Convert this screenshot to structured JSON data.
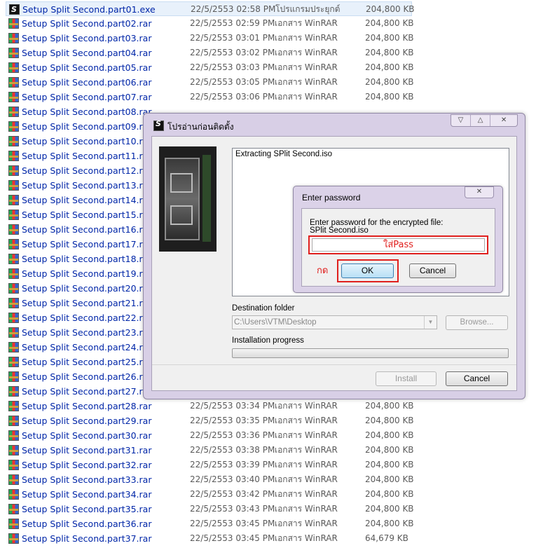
{
  "files": [
    {
      "name": "Setup Split Second.part01.exe",
      "date": "22/5/2553 02:58 PM",
      "type": "โปรแกรมประยุกต์",
      "size": "204,800 KB",
      "icon": "exe-icon"
    },
    {
      "name": "Setup Split Second.part02.rar",
      "date": "22/5/2553 02:59 PM",
      "type": "เอกสาร WinRAR",
      "size": "204,800 KB",
      "icon": "rar-icon"
    },
    {
      "name": "Setup Split Second.part03.rar",
      "date": "22/5/2553 03:01 PM",
      "type": "เอกสาร WinRAR",
      "size": "204,800 KB",
      "icon": "rar-icon"
    },
    {
      "name": "Setup Split Second.part04.rar",
      "date": "22/5/2553 03:02 PM",
      "type": "เอกสาร WinRAR",
      "size": "204,800 KB",
      "icon": "rar-icon"
    },
    {
      "name": "Setup Split Second.part05.rar",
      "date": "22/5/2553 03:03 PM",
      "type": "เอกสาร WinRAR",
      "size": "204,800 KB",
      "icon": "rar-icon"
    },
    {
      "name": "Setup Split Second.part06.rar",
      "date": "22/5/2553 03:05 PM",
      "type": "เอกสาร WinRAR",
      "size": "204,800 KB",
      "icon": "rar-icon"
    },
    {
      "name": "Setup Split Second.part07.rar",
      "date": "22/5/2553 03:06 PM",
      "type": "เอกสาร WinRAR",
      "size": "204,800 KB",
      "icon": "rar-icon"
    },
    {
      "name": "Setup Split Second.part08.rar",
      "date": "",
      "type": "",
      "size": "",
      "icon": "rar-icon"
    },
    {
      "name": "Setup Split Second.part09.rar",
      "date": "",
      "type": "",
      "size": "",
      "icon": "rar-icon"
    },
    {
      "name": "Setup Split Second.part10.rar",
      "date": "",
      "type": "",
      "size": "",
      "icon": "rar-icon"
    },
    {
      "name": "Setup Split Second.part11.rar",
      "date": "",
      "type": "",
      "size": "",
      "icon": "rar-icon"
    },
    {
      "name": "Setup Split Second.part12.rar",
      "date": "",
      "type": "",
      "size": "",
      "icon": "rar-icon"
    },
    {
      "name": "Setup Split Second.part13.rar",
      "date": "",
      "type": "",
      "size": "",
      "icon": "rar-icon"
    },
    {
      "name": "Setup Split Second.part14.rar",
      "date": "",
      "type": "",
      "size": "",
      "icon": "rar-icon"
    },
    {
      "name": "Setup Split Second.part15.rar",
      "date": "",
      "type": "",
      "size": "",
      "icon": "rar-icon"
    },
    {
      "name": "Setup Split Second.part16.rar",
      "date": "",
      "type": "",
      "size": "",
      "icon": "rar-icon"
    },
    {
      "name": "Setup Split Second.part17.rar",
      "date": "",
      "type": "",
      "size": "",
      "icon": "rar-icon"
    },
    {
      "name": "Setup Split Second.part18.rar",
      "date": "",
      "type": "",
      "size": "",
      "icon": "rar-icon"
    },
    {
      "name": "Setup Split Second.part19.rar",
      "date": "",
      "type": "",
      "size": "",
      "icon": "rar-icon"
    },
    {
      "name": "Setup Split Second.part20.rar",
      "date": "",
      "type": "",
      "size": "",
      "icon": "rar-icon"
    },
    {
      "name": "Setup Split Second.part21.rar",
      "date": "",
      "type": "",
      "size": "",
      "icon": "rar-icon"
    },
    {
      "name": "Setup Split Second.part22.rar",
      "date": "",
      "type": "",
      "size": "",
      "icon": "rar-icon"
    },
    {
      "name": "Setup Split Second.part23.rar",
      "date": "",
      "type": "",
      "size": "",
      "icon": "rar-icon"
    },
    {
      "name": "Setup Split Second.part24.rar",
      "date": "",
      "type": "",
      "size": "",
      "icon": "rar-icon"
    },
    {
      "name": "Setup Split Second.part25.rar",
      "date": "",
      "type": "",
      "size": "",
      "icon": "rar-icon"
    },
    {
      "name": "Setup Split Second.part26.rar",
      "date": "",
      "type": "",
      "size": "",
      "icon": "rar-icon"
    },
    {
      "name": "Setup Split Second.part27.rar",
      "date": "",
      "type": "",
      "size": "",
      "icon": "rar-icon"
    },
    {
      "name": "Setup Split Second.part28.rar",
      "date": "22/5/2553 03:34 PM",
      "type": "เอกสาร WinRAR",
      "size": "204,800 KB",
      "icon": "rar-icon"
    },
    {
      "name": "Setup Split Second.part29.rar",
      "date": "22/5/2553 03:35 PM",
      "type": "เอกสาร WinRAR",
      "size": "204,800 KB",
      "icon": "rar-icon"
    },
    {
      "name": "Setup Split Second.part30.rar",
      "date": "22/5/2553 03:36 PM",
      "type": "เอกสาร WinRAR",
      "size": "204,800 KB",
      "icon": "rar-icon"
    },
    {
      "name": "Setup Split Second.part31.rar",
      "date": "22/5/2553 03:38 PM",
      "type": "เอกสาร WinRAR",
      "size": "204,800 KB",
      "icon": "rar-icon"
    },
    {
      "name": "Setup Split Second.part32.rar",
      "date": "22/5/2553 03:39 PM",
      "type": "เอกสาร WinRAR",
      "size": "204,800 KB",
      "icon": "rar-icon"
    },
    {
      "name": "Setup Split Second.part33.rar",
      "date": "22/5/2553 03:40 PM",
      "type": "เอกสาร WinRAR",
      "size": "204,800 KB",
      "icon": "rar-icon"
    },
    {
      "name": "Setup Split Second.part34.rar",
      "date": "22/5/2553 03:42 PM",
      "type": "เอกสาร WinRAR",
      "size": "204,800 KB",
      "icon": "rar-icon"
    },
    {
      "name": "Setup Split Second.part35.rar",
      "date": "22/5/2553 03:43 PM",
      "type": "เอกสาร WinRAR",
      "size": "204,800 KB",
      "icon": "rar-icon"
    },
    {
      "name": "Setup Split Second.part36.rar",
      "date": "22/5/2553 03:45 PM",
      "type": "เอกสาร WinRAR",
      "size": "204,800 KB",
      "icon": "rar-icon"
    },
    {
      "name": "Setup Split Second.part37.rar",
      "date": "22/5/2553 03:45 PM",
      "type": "เอกสาร WinRAR",
      "size": "64,679 KB",
      "icon": "rar-icon"
    }
  ],
  "installer": {
    "title": "โปรอ่านก่อนติดตั้ง",
    "caption_buttons": [
      "▽",
      "△",
      "✕"
    ],
    "log_text": "Extracting SPlit Second.iso",
    "destination_label": "Destination folder",
    "destination_value": "C:\\Users\\VTM\\Desktop",
    "browse_label": "Browse...",
    "progress_label": "Installation progress",
    "progress_fraction": 0,
    "install_label": "Install",
    "cancel_label": "Cancel"
  },
  "password_dialog": {
    "title": "Enter password",
    "close_glyph": "✕",
    "message_line1": "Enter password for the encrypted file:",
    "message_line2": "SPlit Second.iso",
    "input_annotation": "ใส่Pass",
    "press_annotation": "กด",
    "ok_label": "OK",
    "cancel_label": "Cancel",
    "annotation_color": "#e0201e"
  }
}
